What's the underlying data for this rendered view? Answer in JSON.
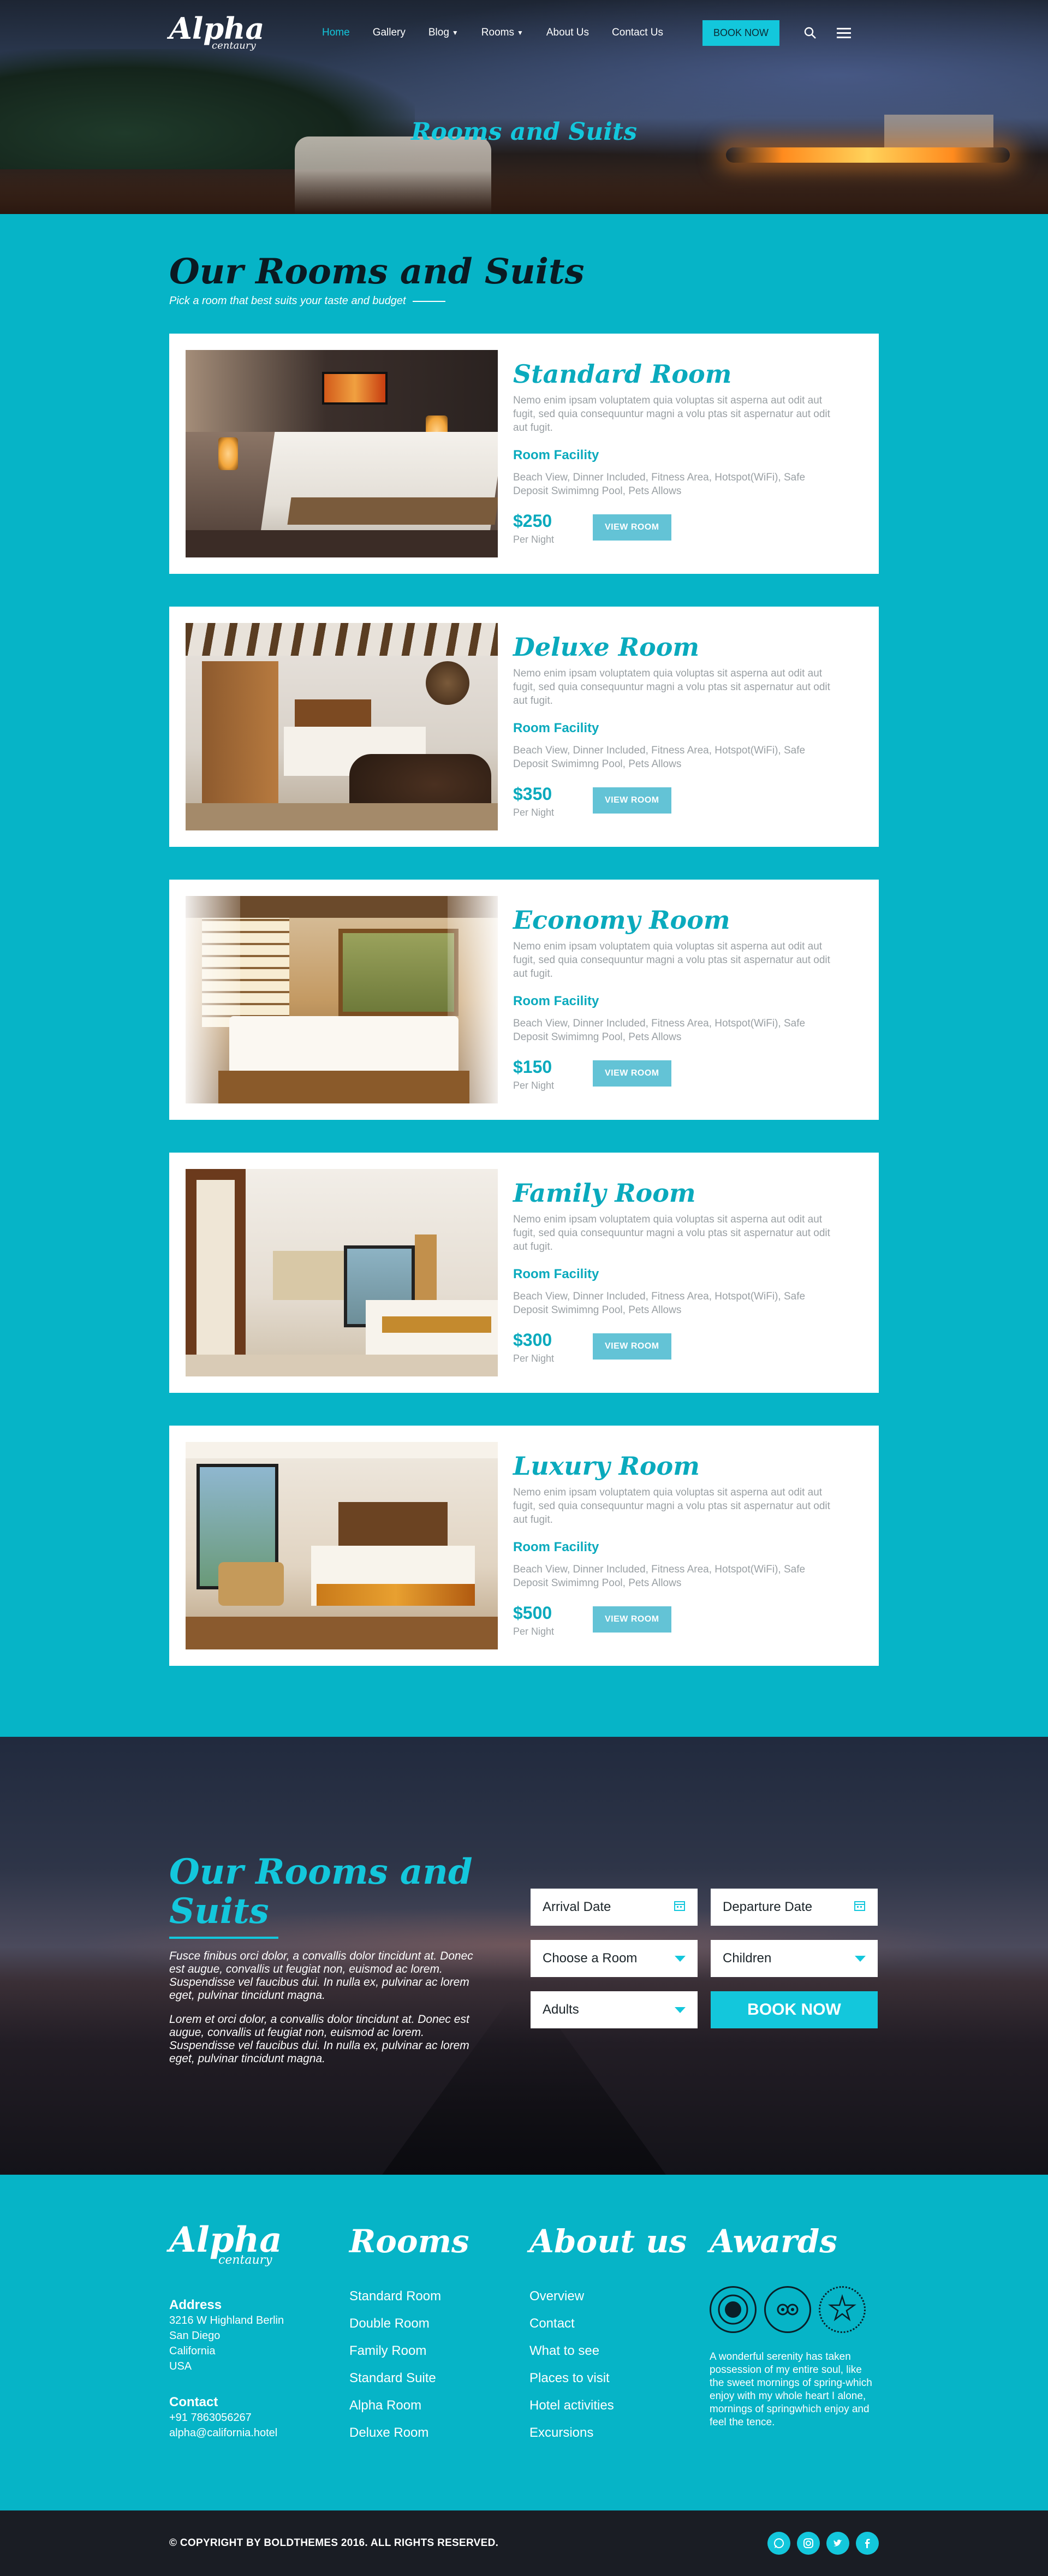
{
  "brand": {
    "logo_main": "Alpha",
    "logo_sub": "centaury"
  },
  "nav": {
    "items": [
      {
        "label": "Home",
        "dropdown": false
      },
      {
        "label": "Gallery",
        "dropdown": false
      },
      {
        "label": "Blog",
        "dropdown": true
      },
      {
        "label": "Rooms",
        "dropdown": true
      },
      {
        "label": "About Us",
        "dropdown": false
      },
      {
        "label": "Contact Us",
        "dropdown": false
      }
    ],
    "book_label": "BOOK NOW",
    "search_icon": "search-icon",
    "menu_icon": "hamburger-icon"
  },
  "hero": {
    "title": "Rooms and Suits"
  },
  "rooms_section": {
    "title": "Our Rooms and Suits",
    "subtitle": "Pick a room that best suits your taste and budget",
    "rooms": [
      {
        "name": "Standard Room",
        "desc": "Nemo enim ipsam voluptatem quia voluptas sit asperna aut odit aut fugit, sed quia consequuntur magni a volu ptas sit aspernatur aut odit aut fugit.",
        "facility_label": "Room Facility",
        "facilities": "Beach View, Dinner Included, Fitness Area, Hotspot(WiFi), Safe Deposit Swimimng Pool, Pets Allows",
        "price": "$250",
        "per": "Per Night",
        "button": "VIEW ROOM"
      },
      {
        "name": "Deluxe Room",
        "desc": "Nemo enim ipsam voluptatem quia voluptas sit asperna aut odit aut fugit, sed quia consequuntur magni a volu ptas sit aspernatur aut odit aut fugit.",
        "facility_label": "Room Facility",
        "facilities": "Beach View, Dinner Included, Fitness Area, Hotspot(WiFi), Safe Deposit Swimimng Pool, Pets Allows",
        "price": "$350",
        "per": "Per Night",
        "button": "VIEW ROOM"
      },
      {
        "name": "Economy Room",
        "desc": "Nemo enim ipsam voluptatem quia voluptas sit asperna aut odit aut fugit, sed quia consequuntur magni a volu ptas sit aspernatur aut odit aut fugit.",
        "facility_label": "Room Facility",
        "facilities": "Beach View, Dinner Included, Fitness Area, Hotspot(WiFi), Safe Deposit Swimimng Pool, Pets Allows",
        "price": "$150",
        "per": "Per Night",
        "button": "VIEW ROOM"
      },
      {
        "name": "Family Room",
        "desc": "Nemo enim ipsam voluptatem quia voluptas sit asperna aut odit aut fugit, sed quia consequuntur magni a volu ptas sit aspernatur aut odit aut fugit.",
        "facility_label": "Room Facility",
        "facilities": "Beach View, Dinner Included, Fitness Area, Hotspot(WiFi), Safe Deposit Swimimng Pool, Pets Allows",
        "price": "$300",
        "per": "Per Night",
        "button": "VIEW ROOM"
      },
      {
        "name": "Luxury Room",
        "desc": "Nemo enim ipsam voluptatem quia voluptas sit asperna aut odit aut fugit, sed quia consequuntur magni a volu ptas sit aspernatur aut odit aut fugit.",
        "facility_label": "Room Facility",
        "facilities": "Beach View, Dinner Included, Fitness Area, Hotspot(WiFi), Safe Deposit Swimimng Pool, Pets Allows",
        "price": "$500",
        "per": "Per Night",
        "button": "VIEW ROOM"
      }
    ]
  },
  "booking": {
    "title": "Our Rooms and Suits",
    "text1": "Fusce finibus orci dolor, a convallis dolor tincidunt at. Donec est augue, convallis ut feugiat non, euismod ac lorem. Suspendisse vel faucibus dui. In nulla ex, pulvinar ac lorem eget, pulvinar tincidunt magna.",
    "text2": "Lorem et orci dolor, a convallis dolor tincidunt at. Donec est augue, convallis ut feugiat non, euismod ac lorem. Suspendisse vel faucibus dui. In nulla ex, pulvinar ac lorem eget, pulvinar tincidunt magna.",
    "arrival": "Arrival Date",
    "departure": "Departure Date",
    "room": "Choose a Room",
    "children": "Children",
    "adults": "Adults",
    "submit": "BOOK NOW"
  },
  "footer": {
    "logo_main": "Alpha",
    "logo_sub": "centaury",
    "address_h": "Address",
    "address_lines": [
      "3216 W Highland Berlin",
      "San Diego",
      "California",
      "USA"
    ],
    "contact_h": "Contact",
    "phone": "+91 7863056267",
    "email": "alpha@california.hotel",
    "rooms_h": "Rooms",
    "rooms_links": [
      "Standard Room",
      "Double Room",
      "Family Room",
      "Standard Suite",
      "Alpha Room",
      "Deluxe Room"
    ],
    "about_h": "About us",
    "about_links": [
      "Overview",
      "Contact",
      "What to see",
      "Places to visit",
      "Hotel activities",
      "Excursions"
    ],
    "awards_h": "Awards",
    "award_text": "A wonderful serenity has taken possession of my entire soul, like the sweet mornings of spring-which enjoy with my whole heart I alone, mornings of springwhich enjoy and feel the tence."
  },
  "copyright": "© COPYRIGHT BY BOLDTHEMES 2016. ALL RIGHTS RESERVED.",
  "socials": [
    "whatsapp-icon",
    "instagram-icon",
    "twitter-icon",
    "facebook-icon"
  ],
  "colors": {
    "accent": "#13c7dc",
    "background": "#06b4c7",
    "button_muted": "#63c3d6",
    "dark": "#1a1d24"
  }
}
